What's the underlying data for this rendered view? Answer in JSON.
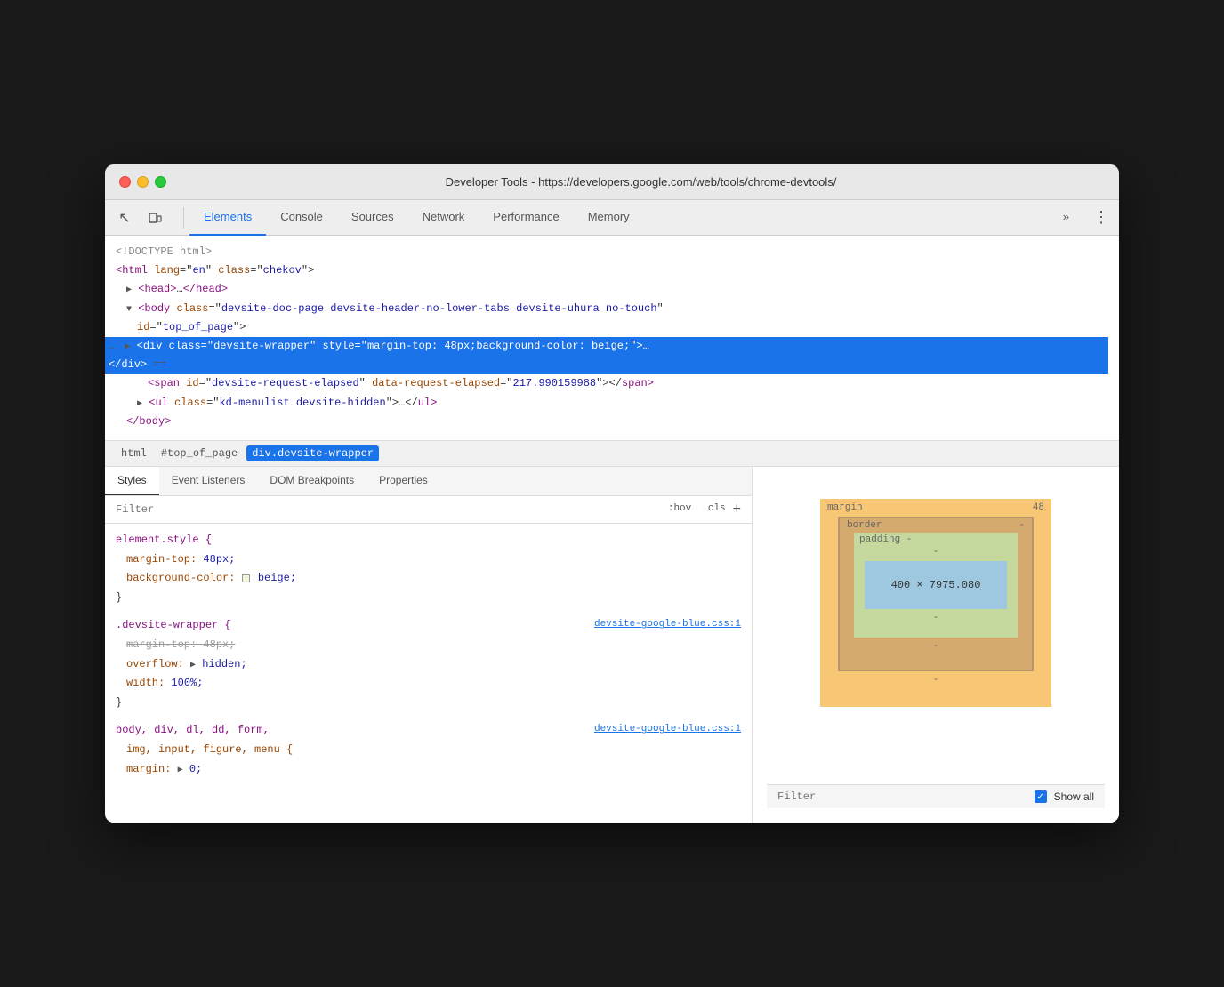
{
  "window": {
    "title": "Developer Tools - https://developers.google.com/web/tools/chrome-devtools/"
  },
  "toolbar": {
    "icons": [
      {
        "name": "cursor-icon",
        "symbol": "↖"
      },
      {
        "name": "device-icon",
        "symbol": "⬜"
      }
    ],
    "tabs": [
      {
        "id": "elements",
        "label": "Elements",
        "active": true
      },
      {
        "id": "console",
        "label": "Console",
        "active": false
      },
      {
        "id": "sources",
        "label": "Sources",
        "active": false
      },
      {
        "id": "network",
        "label": "Network",
        "active": false
      },
      {
        "id": "performance",
        "label": "Performance",
        "active": false
      },
      {
        "id": "memory",
        "label": "Memory",
        "active": false
      }
    ],
    "more_label": "»",
    "menu_label": "⋮"
  },
  "dom_tree": {
    "lines": [
      {
        "indent": 0,
        "text": "<!DOCTYPE html>",
        "type": "comment"
      },
      {
        "indent": 0,
        "html": "<html lang=\"en\" class=\"chekov\">"
      },
      {
        "indent": 1,
        "html": "▶ <head>…</head>"
      },
      {
        "indent": 1,
        "html": "▼ <body class=\"devsite-doc-page devsite-header-no-lower-tabs devsite-uhura no-touch\""
      },
      {
        "indent": 1,
        "html": "    id=\"top_of_page\">"
      },
      {
        "indent": 2,
        "html": "…  ▶ <div class=\"devsite-wrapper\" style=\"margin-top: 48px;background-color: beige;\">…"
      },
      {
        "indent": 3,
        "html": "   </div> == $0"
      },
      {
        "indent": 3,
        "html": "<span id=\"devsite-request-elapsed\" data-request-elapsed=\"217.990159988\"></span>"
      },
      {
        "indent": 2,
        "html": "  ▶ <ul class=\"kd-menulist devsite-hidden\">…</ul>"
      },
      {
        "indent": 1,
        "html": "</body>"
      }
    ]
  },
  "breadcrumb": {
    "items": [
      {
        "label": "html",
        "active": false
      },
      {
        "label": "#top_of_page",
        "active": false
      },
      {
        "label": "div.devsite-wrapper",
        "active": true
      }
    ]
  },
  "sub_tabs": {
    "tabs": [
      {
        "label": "Styles",
        "active": true
      },
      {
        "label": "Event Listeners",
        "active": false
      },
      {
        "label": "DOM Breakpoints",
        "active": false
      },
      {
        "label": "Properties",
        "active": false
      }
    ]
  },
  "filter": {
    "placeholder": "Filter",
    "hov_btn": ":hov",
    "cls_btn": ".cls",
    "plus_btn": "+"
  },
  "styles": {
    "rules": [
      {
        "selector": "element.style {",
        "link": null,
        "properties": [
          {
            "prop": "margin-top:",
            "value": "48px;",
            "strikethrough": false
          },
          {
            "prop": "background-color:",
            "value": "beige;",
            "strikethrough": false,
            "swatch": true
          }
        ],
        "close": "}"
      },
      {
        "selector": ".devsite-wrapper {",
        "link": "devsite-google-blue.css:1",
        "properties": [
          {
            "prop": "margin-top:",
            "value": "48px;",
            "strikethrough": true
          },
          {
            "prop": "overflow:",
            "value": "hidden;",
            "strikethrough": false,
            "arrow": true
          },
          {
            "prop": "width:",
            "value": "100%;",
            "strikethrough": false
          }
        ],
        "close": "}"
      },
      {
        "selector": "body, div, dl, dd, form,",
        "link": "devsite-google-blue.css:1",
        "properties": [
          {
            "prop": "img, input, figure, menu {",
            "value": "",
            "strikethrough": false
          },
          {
            "prop": "margin:",
            "value": "▶ 0;",
            "strikethrough": false,
            "arrow": true
          }
        ]
      }
    ]
  },
  "box_model": {
    "margin_label": "margin",
    "margin_value": "48",
    "border_label": "border",
    "border_value": "-",
    "padding_label": "padding -",
    "content_value": "400 × 7975.080",
    "dash_values": [
      "-",
      "-",
      "-"
    ]
  },
  "bottom_bar": {
    "filter_placeholder": "Filter",
    "show_all_label": "Show all"
  }
}
